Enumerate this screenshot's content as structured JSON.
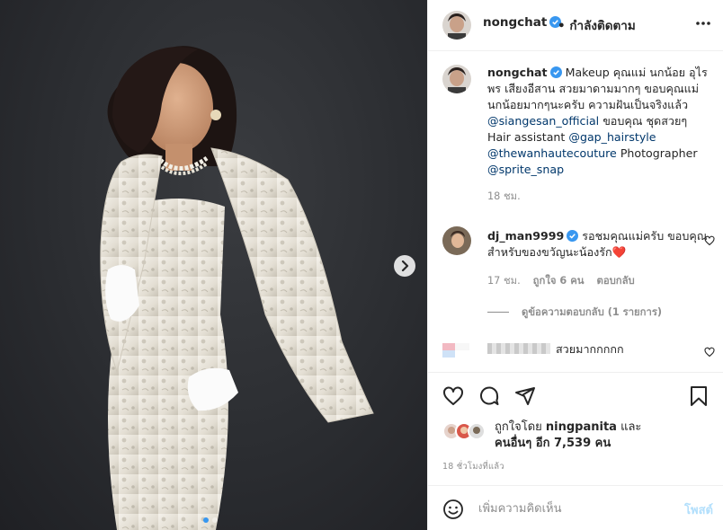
{
  "colors": {
    "accent": "#0095f6",
    "verified": "#3897f0",
    "heart": "#ed4956",
    "muted": "#8e8e8e",
    "link": "#00376b"
  },
  "header": {
    "username": "nongchat",
    "separator": "•",
    "follow_state": "กำลังติดตาม",
    "more_icon": "more-horizontal-icon"
  },
  "caption": {
    "username": "nongchat",
    "text_1": "Makeup คุณแม่ นกน้อย อุไรพร เสียงอีสาน สวยมาดามมากๆ ขอบคุณแม่นกน้อยมากๆนะครับ ความฝันเป็นจริงแล้ว ",
    "mention_1": "@siangesan_official",
    "text_2": " ขอบคุณ ชุดสวยๆ Hair assistant ",
    "mention_2": "@gap_hairstyle",
    "mention_3": "@thewanhautecouture",
    "text_3": " Photographer ",
    "mention_4": "@sprite_snap",
    "time": "18 ชม."
  },
  "comment_1": {
    "username": "dj_man9999",
    "text": "รอชมคุณแม่ครับ ขอบคุณสำหรับของขวัญนะน้องรัก",
    "emoji": "❤️",
    "time": "17 ชม.",
    "likes": "ถูกใจ 6 คน",
    "reply": "ตอบกลับ",
    "view_replies": "ดูข้อความตอบกลับ (1 รายการ)"
  },
  "comment_2": {
    "text": "สวยมากกกกก"
  },
  "actions": {
    "like_icon": "heart-icon",
    "comment_icon": "comment-icon",
    "share_icon": "share-icon",
    "save_icon": "bookmark-icon"
  },
  "likes": {
    "prefix": "ถูกใจโดย ",
    "user": "ningpanita",
    "middle": " และ",
    "others": "คนอื่นๆ อีก 7,539 คน"
  },
  "posted": "18 ชั่วโมงที่แล้ว",
  "add_comment": {
    "placeholder": "เพิ่มความคิดเห็น",
    "post_label": "โพสต์"
  },
  "carousel": {
    "slides": 2,
    "current": 1
  }
}
